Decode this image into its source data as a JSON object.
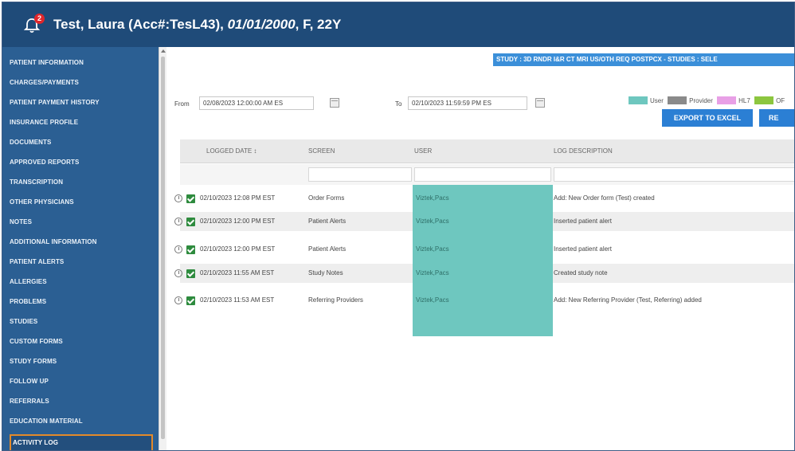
{
  "header": {
    "notification_count": "2",
    "patient_name": "Test, Laura (Acc#:TesL43),",
    "patient_dob": "01/01/2000",
    "patient_details": ", F, 22Y"
  },
  "sidebar": {
    "items": [
      {
        "label": "PATIENT INFORMATION"
      },
      {
        "label": "CHARGES/PAYMENTS"
      },
      {
        "label": "PATIENT PAYMENT HISTORY"
      },
      {
        "label": "INSURANCE PROFILE"
      },
      {
        "label": "DOCUMENTS"
      },
      {
        "label": "APPROVED REPORTS"
      },
      {
        "label": "TRANSCRIPTION"
      },
      {
        "label": "OTHER PHYSICIANS"
      },
      {
        "label": "NOTES"
      },
      {
        "label": "ADDITIONAL INFORMATION"
      },
      {
        "label": "PATIENT ALERTS"
      },
      {
        "label": "ALLERGIES"
      },
      {
        "label": "PROBLEMS"
      },
      {
        "label": "STUDIES"
      },
      {
        "label": "CUSTOM FORMS"
      },
      {
        "label": "STUDY FORMS"
      },
      {
        "label": "FOLLOW UP"
      },
      {
        "label": "REFERRALS"
      },
      {
        "label": "EDUCATION MATERIAL"
      },
      {
        "label": "ACTIVITY LOG"
      }
    ],
    "active": "ACTIVITY LOG"
  },
  "study_bar": {
    "text": "STUDY : 3D RNDR I&R CT MRI US/OTH REQ POSTPCX   -   STUDIES : SELE"
  },
  "filters": {
    "from_label": "From",
    "from_value": "02/08/2023 12:00:00 AM ES",
    "to_label": "To",
    "to_value": "02/10/2023 11:59:59 PM ES"
  },
  "legend": {
    "items": [
      {
        "label": "User",
        "color": "#6ec7bf"
      },
      {
        "label": "Provider",
        "color": "#8a8a8a"
      },
      {
        "label": "HL7",
        "color": "#e8a0e6"
      },
      {
        "label": "OF",
        "color": "#8cc63f"
      }
    ]
  },
  "buttons": {
    "export": "EXPORT TO EXCEL",
    "refresh": "RE"
  },
  "grid": {
    "headers": {
      "logged_date": "LOGGED DATE ↕",
      "screen": "SCREEN",
      "user": "USER",
      "log_description": "LOG DESCRIPTION"
    },
    "rows": [
      {
        "date": "02/10/2023 12:08 PM EST",
        "screen": "Order Forms",
        "user": "Viztek,Pacs",
        "description": "Add: New Order form (Test) created"
      },
      {
        "date": "02/10/2023 12:00 PM EST",
        "screen": "Patient Alerts",
        "user": "Viztek,Pacs",
        "description": "Inserted patient alert"
      },
      {
        "date": "02/10/2023 12:00 PM EST",
        "screen": "Patient Alerts",
        "user": "Viztek,Pacs",
        "description": "Inserted patient alert"
      },
      {
        "date": "02/10/2023 11:55 AM EST",
        "screen": "Study Notes",
        "user": "Viztek,Pacs",
        "description": "Created study note"
      },
      {
        "date": "02/10/2023 11:53 AM EST",
        "screen": "Referring Providers",
        "user": "Viztek,Pacs",
        "description": "Add: New Referring Provider (Test, Referring) added"
      }
    ]
  },
  "colors": {
    "header_bg": "#1f4b79",
    "sidebar_bg": "#2b5f93",
    "accent": "#2b7fd4",
    "user_highlight": "#6ec7bf",
    "active_border": "#e38a2a"
  }
}
